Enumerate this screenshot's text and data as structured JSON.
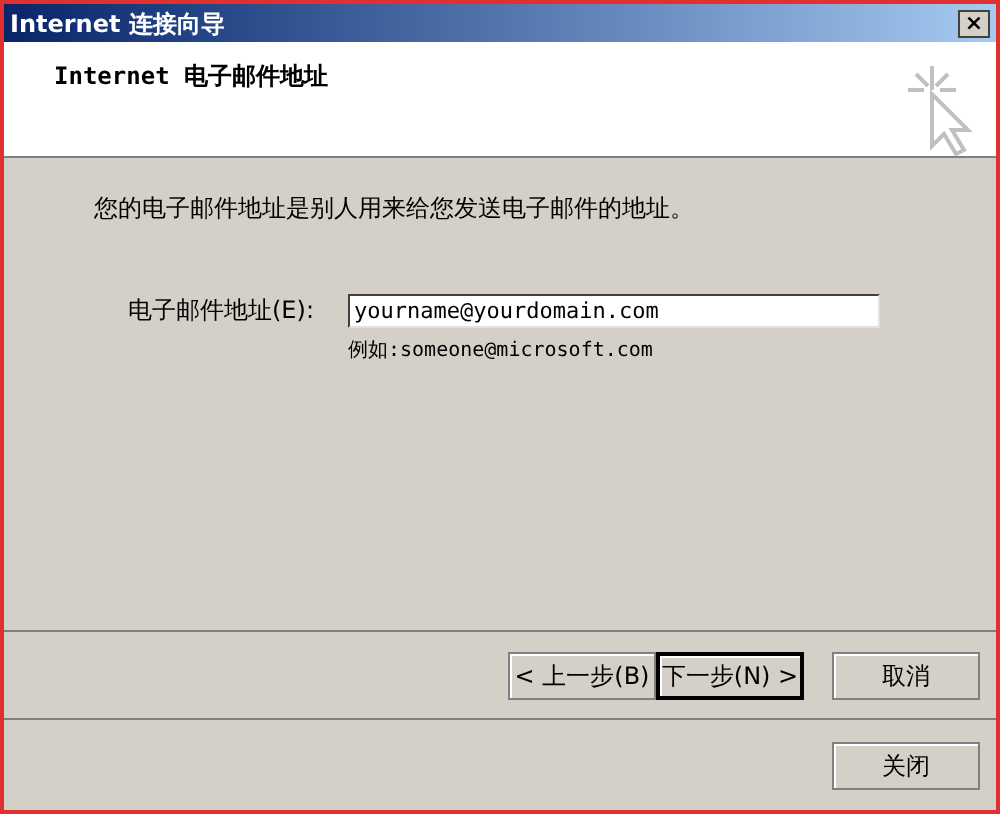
{
  "window": {
    "title": "Internet 连接向导",
    "close": "×"
  },
  "header": {
    "title": "Internet 电子邮件地址"
  },
  "description": "您的电子邮件地址是别人用来给您发送电子邮件的地址。",
  "email": {
    "label": "电子邮件地址(E):",
    "value": "yourname@yourdomain.com",
    "hint": "例如:someone@microsoft.com"
  },
  "buttons": [
    {
      "label": "< 上一步(B)",
      "default": false
    },
    {
      "label": "下一步(N) >",
      "default": true
    },
    {
      "label": "取消",
      "default": false
    }
  ],
  "footer_button": "关闭"
}
